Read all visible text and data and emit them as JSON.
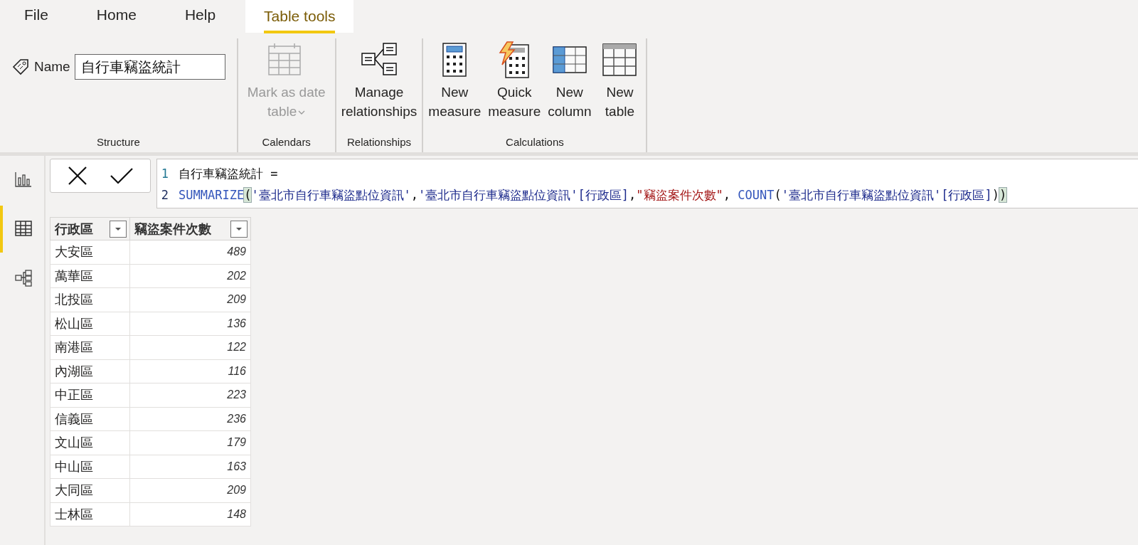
{
  "tabs": [
    {
      "label": "File",
      "selected": false
    },
    {
      "label": "Home",
      "selected": false
    },
    {
      "label": "Help",
      "selected": false
    },
    {
      "label": "Table tools",
      "selected": true
    }
  ],
  "ribbon": {
    "groups": [
      {
        "label": "Structure",
        "kind": "name",
        "name_label": "Name",
        "name_value": "自行車竊盜統計"
      },
      {
        "label": "Calendars",
        "kind": "buttons",
        "buttons": [
          {
            "kind": "date-table",
            "label": "Mark as date table",
            "dropdown": true,
            "disabled": true
          }
        ]
      },
      {
        "label": "Relationships",
        "kind": "buttons",
        "buttons": [
          {
            "kind": "relationships",
            "label": "Manage relationships",
            "dropdown": false,
            "disabled": false
          }
        ]
      },
      {
        "label": "Calculations",
        "kind": "buttons",
        "buttons": [
          {
            "kind": "measure",
            "label": "New measure",
            "dropdown": false,
            "disabled": false
          },
          {
            "kind": "quick-measure",
            "label": "Quick measure",
            "dropdown": false,
            "disabled": false
          },
          {
            "kind": "column",
            "label": "New column",
            "dropdown": false,
            "disabled": false
          },
          {
            "kind": "table",
            "label": "New table",
            "dropdown": false,
            "disabled": false
          }
        ]
      }
    ]
  },
  "sidebar": {
    "items": [
      {
        "kind": "report",
        "selected": false
      },
      {
        "kind": "data",
        "selected": true
      },
      {
        "kind": "model",
        "selected": false
      }
    ]
  },
  "formula": {
    "lines": [
      {
        "number": "1",
        "tokens": [
          {
            "kind": "plain",
            "text": "自行車竊盜統計 ="
          }
        ]
      },
      {
        "number": "2",
        "tokens": [
          {
            "kind": "function",
            "text": "SUMMARIZE"
          },
          {
            "kind": "match",
            "text": "("
          },
          {
            "kind": "table",
            "text": "'臺北市自行車竊盜點位資訊'"
          },
          {
            "kind": "plain",
            "text": ","
          },
          {
            "kind": "table",
            "text": "'臺北市自行車竊盜點位資訊'[行政區]"
          },
          {
            "kind": "plain",
            "text": ","
          },
          {
            "kind": "string",
            "text": "\"竊盜案件次數\""
          },
          {
            "kind": "plain",
            "text": ", "
          },
          {
            "kind": "function",
            "text": "COUNT"
          },
          {
            "kind": "plain",
            "text": "("
          },
          {
            "kind": "table",
            "text": "'臺北市自行車竊盜點位資訊'[行政區]"
          },
          {
            "kind": "plain",
            "text": ")"
          },
          {
            "kind": "match",
            "text": ")"
          }
        ]
      }
    ]
  },
  "table": {
    "columns": [
      "行政區",
      "竊盜案件次數"
    ],
    "rows": [
      [
        "大安區",
        "489"
      ],
      [
        "萬華區",
        "202"
      ],
      [
        "北投區",
        "209"
      ],
      [
        "松山區",
        "136"
      ],
      [
        "南港區",
        "122"
      ],
      [
        "內湖區",
        "116"
      ],
      [
        "中正區",
        "223"
      ],
      [
        "信義區",
        "236"
      ],
      [
        "文山區",
        "179"
      ],
      [
        "中山區",
        "163"
      ],
      [
        "大同區",
        "209"
      ],
      [
        "士林區",
        "148"
      ]
    ]
  }
}
